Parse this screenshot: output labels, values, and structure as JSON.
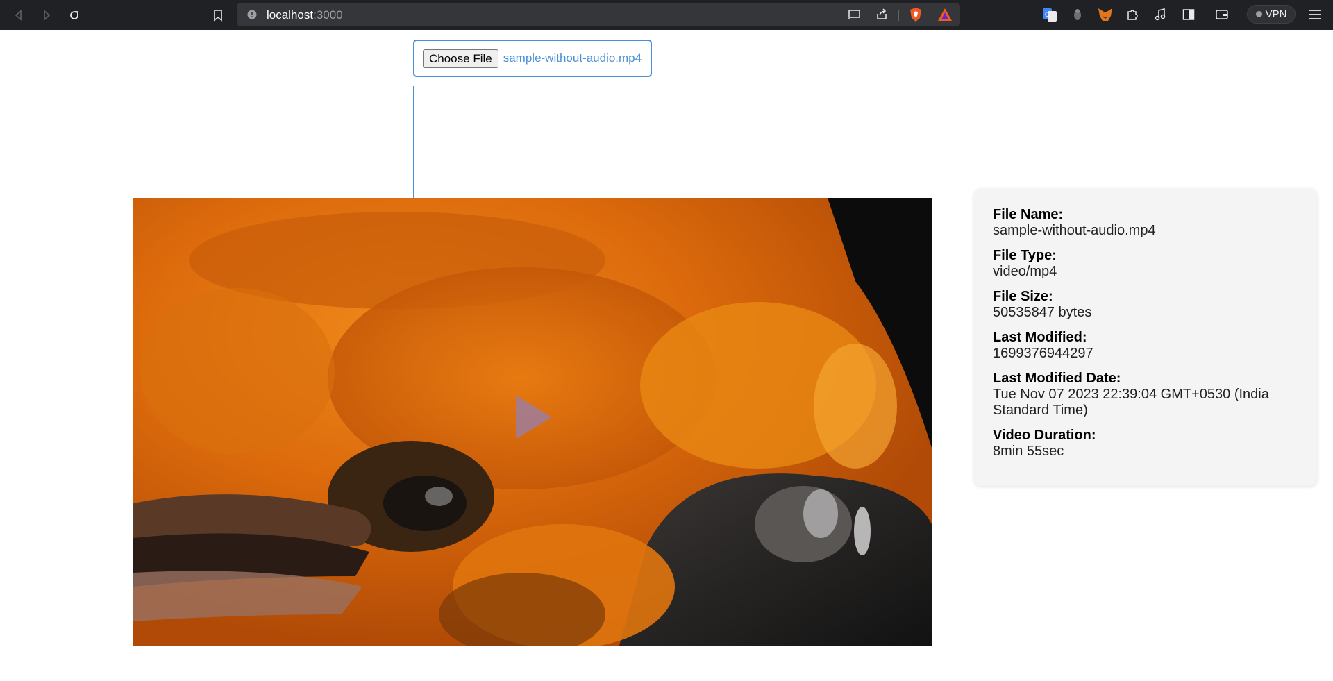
{
  "browser": {
    "url_host": "localhost",
    "url_port": ":3000",
    "vpn_label": "VPN",
    "icons": [
      "back-icon",
      "forward-icon",
      "reload-icon",
      "bookmark-icon",
      "site-info-icon",
      "cast-icon",
      "share-icon",
      "brave-shields-icon",
      "brave-rewards-icon",
      "translate-icon",
      "extension-a-icon",
      "metamask-icon",
      "extensions-puzzle-icon",
      "media-controls-icon",
      "sidebar-icon",
      "wallet-icon",
      "menu-icon"
    ]
  },
  "upload": {
    "button_label": "Choose File",
    "selected_file": "sample-without-audio.mp4"
  },
  "video": {
    "state": "paused",
    "play_icon": "play-icon"
  },
  "file_info": {
    "items": [
      {
        "label": "File Name:",
        "value": "sample-without-audio.mp4"
      },
      {
        "label": "File Type:",
        "value": "video/mp4"
      },
      {
        "label": "File Size:",
        "value": "50535847 bytes"
      },
      {
        "label": "Last Modified:",
        "value": "1699376944297"
      },
      {
        "label": "Last Modified Date:",
        "value": "Tue Nov 07 2023 22:39:04 GMT+0530 (India Standard Time)"
      },
      {
        "label": "Video Duration:",
        "value": "8min 55sec"
      }
    ]
  },
  "colors": {
    "chrome_bg": "#202124",
    "accent_blue": "#4a90d9",
    "card_bg": "#f4f4f4"
  }
}
